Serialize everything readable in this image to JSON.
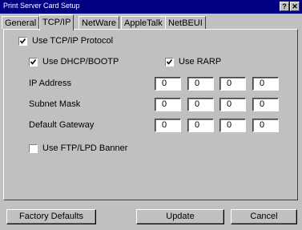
{
  "window": {
    "title": "Print Server Card Setup",
    "help_button": "?",
    "close_button": "✕"
  },
  "tabs": [
    "General",
    "TCP/IP",
    "NetWare",
    "AppleTalk",
    "NetBEUI"
  ],
  "active_tab": "TCP/IP",
  "tcpip": {
    "use_tcpip": {
      "label": "Use TCP/IP Protocol",
      "checked": true
    },
    "use_dhcp": {
      "label": "Use DHCP/BOOTP",
      "checked": true
    },
    "use_rarp": {
      "label": "Use RARP",
      "checked": true
    },
    "ip_address": {
      "label": "IP Address",
      "octets": [
        "0",
        "0",
        "0",
        "0"
      ]
    },
    "subnet_mask": {
      "label": "Subnet Mask",
      "octets": [
        "0",
        "0",
        "0",
        "0"
      ]
    },
    "default_gateway": {
      "label": "Default Gateway",
      "octets": [
        "0",
        "0",
        "0",
        "0"
      ]
    },
    "use_ftp_banner": {
      "label": "Use FTP/LPD Banner",
      "checked": false
    }
  },
  "buttons": {
    "factory_defaults": "Factory Defaults",
    "update": "Update",
    "cancel": "Cancel"
  }
}
